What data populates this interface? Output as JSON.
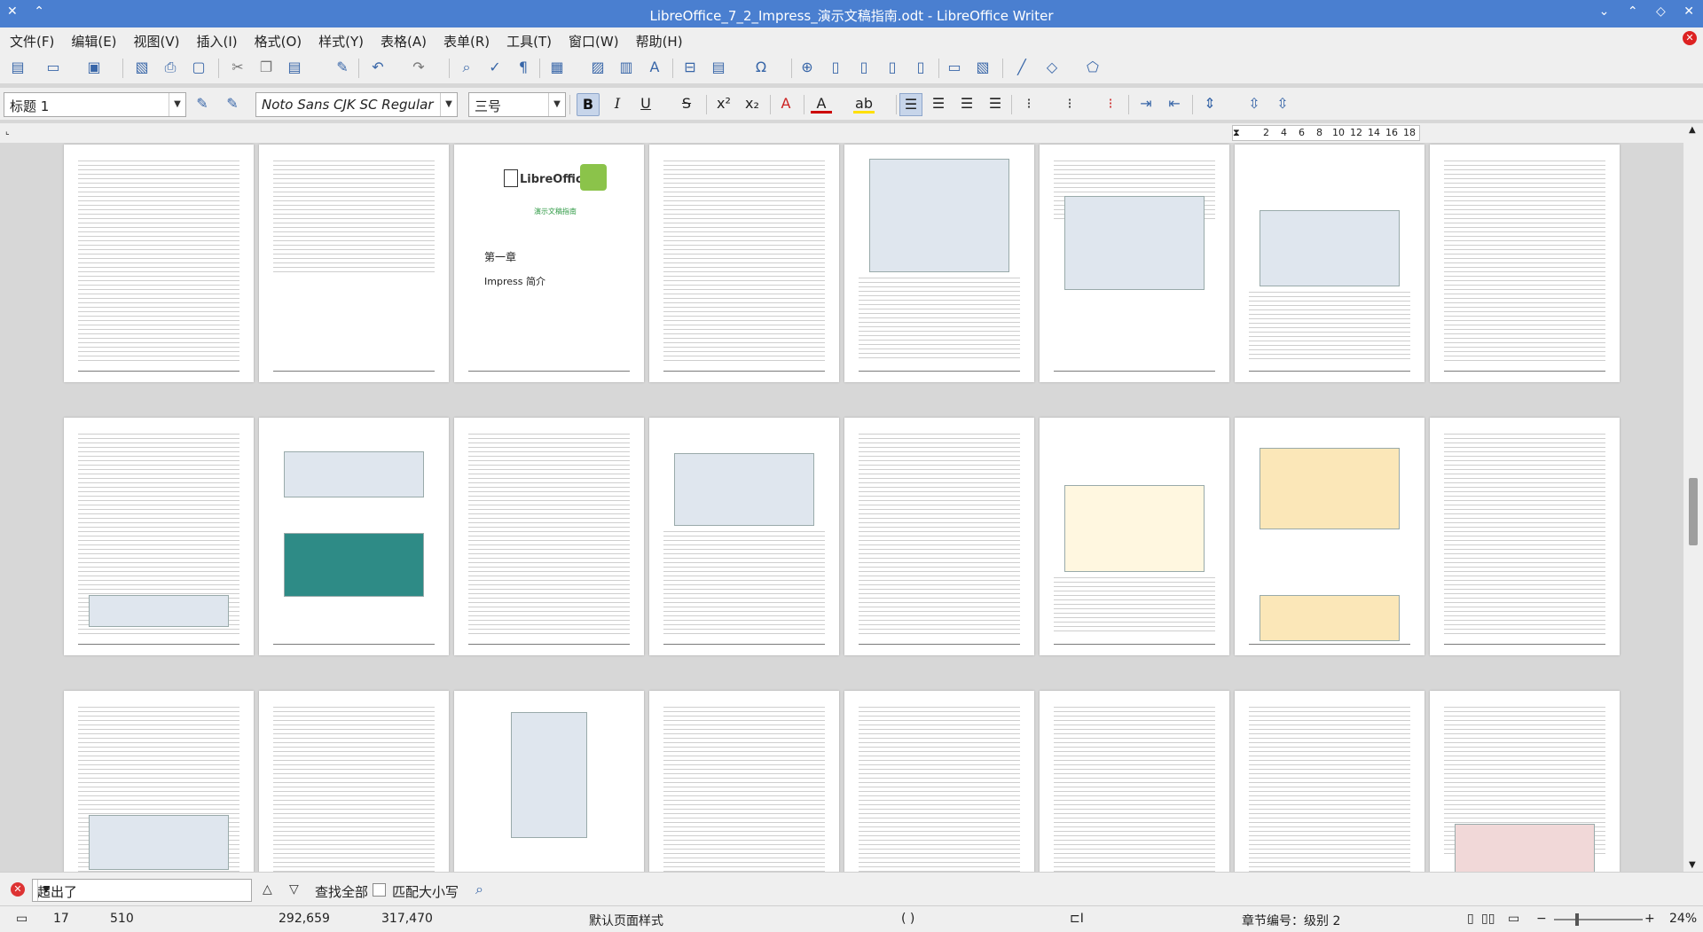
{
  "window": {
    "title": "LibreOffice_7_2_Impress_演示文稿指南.odt - LibreOffice Writer"
  },
  "menu": [
    "文件(F)",
    "编辑(E)",
    "视图(V)",
    "插入(I)",
    "格式(O)",
    "样式(Y)",
    "表格(A)",
    "表单(R)",
    "工具(T)",
    "窗口(W)",
    "帮助(H)"
  ],
  "formatting": {
    "paragraph_style": "标题 1",
    "font_name": "Noto Sans CJK SC Regular",
    "font_size": "三号"
  },
  "cover_page": {
    "logo": "LibreOffice",
    "subtitle": "演示文稿指南",
    "chapter": "第一章",
    "chapter_title": "Impress 简介"
  },
  "ruler": {
    "ticks": [
      "2",
      "4",
      "6",
      "8",
      "10",
      "12",
      "14",
      "16",
      "18"
    ]
  },
  "find": {
    "search_text": "超出了",
    "find_all": "查找全部",
    "match_case": "匹配大小写"
  },
  "status": {
    "page": "17",
    "words": "510",
    "coord1": "292,659",
    "coord2": "317,470",
    "page_style": "默认页面样式",
    "lang": "(     )",
    "chapter_info": "章节编号：级别 2",
    "zoom": "24%"
  }
}
